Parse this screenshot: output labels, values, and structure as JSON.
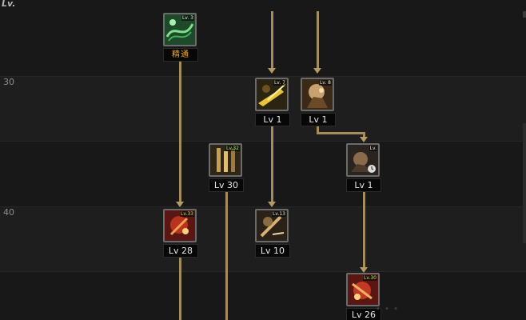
{
  "header": {
    "level_label": "Lv."
  },
  "rows": [
    {
      "level": "30"
    },
    {
      "level": "40"
    }
  ],
  "skills": [
    {
      "id": "mastery",
      "badge": "Lv. 3",
      "caption": "精通",
      "badge_color": "#eaeaea",
      "palette": "green"
    },
    {
      "id": "skill-a",
      "badge": "Lv. 7",
      "caption": "Lv 1",
      "badge_color": "#eaeaea",
      "palette": "gold"
    },
    {
      "id": "skill-b",
      "badge": "Lv. 8",
      "caption": "Lv 1",
      "badge_color": "#eaeaea",
      "palette": "tan"
    },
    {
      "id": "skill-c",
      "badge": "Lv.",
      "caption": "Lv 1",
      "badge_color": "#eaeaea",
      "palette": "dark"
    },
    {
      "id": "skill-d",
      "badge": "Lv.32",
      "caption": "Lv 30",
      "badge_color": "#9dff7a",
      "palette": "brown"
    },
    {
      "id": "skill-e",
      "badge": "Lv.13",
      "caption": "Lv 10",
      "badge_color": "#eaeaea",
      "palette": "bronze"
    },
    {
      "id": "skill-f",
      "badge": "Lv.33",
      "caption": "Lv 28",
      "badge_color": "#9dff7a",
      "palette": "red"
    },
    {
      "id": "skill-g",
      "badge": "Lv.30",
      "caption": "Lv 26",
      "badge_color": "#9dff7a",
      "palette": "red"
    }
  ],
  "colors": {
    "connector": "#a48c5e",
    "mastery_text": "#f2a838",
    "unlocked_badge": "#9dff7a"
  }
}
